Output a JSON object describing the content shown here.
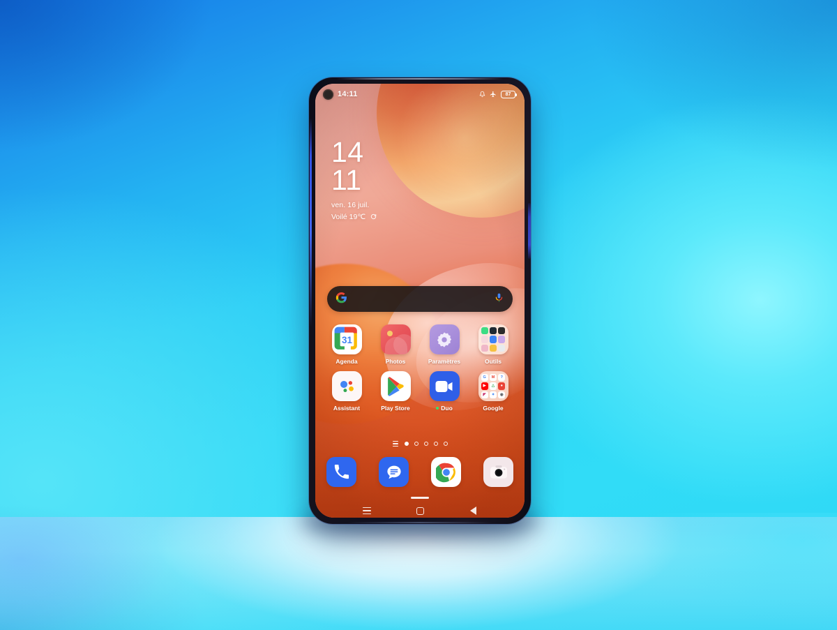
{
  "scene": {
    "description": "Smartphone on glossy surface with blue and cyan studio lighting",
    "background_colors": {
      "top_left_blue": "#1479e8",
      "mid_cyan": "#2ccdf5",
      "glow_cyan": "#8ef6ff",
      "surface_white": "#f6faff"
    }
  },
  "phone": {
    "frame_color": "#101020",
    "accent_edge_color": "#3456f0",
    "buttons": [
      {
        "name": "volume-rocker",
        "side": "left"
      },
      {
        "name": "power-button",
        "side": "right"
      }
    ]
  },
  "statusbar": {
    "time": "14:11",
    "icons": [
      {
        "name": "punch-hole-camera"
      },
      {
        "name": "notification-bell-icon"
      },
      {
        "name": "airplane-mode-icon"
      },
      {
        "name": "battery-icon"
      }
    ],
    "battery_percent": "87"
  },
  "clock_widget": {
    "hours": "14",
    "minutes": "11",
    "date": "ven. 16 juil.",
    "weather": "Voilé 19℃",
    "refresh_icon": "refresh-icon"
  },
  "search": {
    "placeholder": "",
    "left_icon": "google-g-icon",
    "right_icon": "microphone-icon",
    "background": "#161214"
  },
  "apps": {
    "rows": [
      [
        {
          "label": "Agenda",
          "icon": "calendar-icon",
          "badge": "31"
        },
        {
          "label": "Photos",
          "icon": "photos-icon"
        },
        {
          "label": "Paramètres",
          "icon": "settings-gear-icon"
        },
        {
          "label": "Outils",
          "icon": "folder-icon"
        }
      ],
      [
        {
          "label": "Assistant",
          "icon": "google-assistant-icon"
        },
        {
          "label": "Play Store",
          "icon": "play-store-icon"
        },
        {
          "label": "Duo",
          "icon": "duo-video-icon",
          "dot": true
        },
        {
          "label": "Google",
          "icon": "folder-icon"
        }
      ]
    ]
  },
  "page_indicator": {
    "total": 5,
    "active": 1,
    "has_list_icon": true
  },
  "dock": [
    {
      "name": "phone-app",
      "icon": "phone-handset-icon",
      "color": "#2f67ef"
    },
    {
      "name": "messages-app",
      "icon": "messages-bubble-icon",
      "color": "#2f67ef"
    },
    {
      "name": "chrome-app",
      "icon": "chrome-icon",
      "color": "#ffffff"
    },
    {
      "name": "camera-app",
      "icon": "camera-icon",
      "color": "#f3e9ec"
    }
  ],
  "navbar": [
    {
      "name": "recents-button",
      "icon": "hamburger-icon"
    },
    {
      "name": "home-button",
      "icon": "square-icon"
    },
    {
      "name": "back-button",
      "icon": "triangle-back-icon"
    }
  ],
  "folder_tiles": {
    "outils": [
      "#3ddc84",
      "#1f2933",
      "#2b2b2b",
      "#f7d8dd",
      "#3b82f6",
      "#b07de0",
      "#f0b7c8",
      "#f5c242",
      "#e8eaed"
    ],
    "google": [
      "#ffffff",
      "#ea4335",
      "#4285f4",
      "#ff0000",
      "#34a853",
      "#ea4335",
      "#00c2ff",
      "#4285f4",
      "#ffffff"
    ]
  }
}
